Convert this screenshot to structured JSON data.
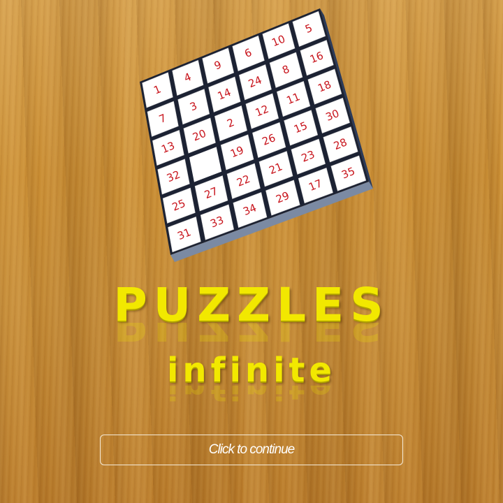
{
  "title": "PUZZLES",
  "subtitle": "infinite",
  "continue_label": "Click to continue",
  "board": {
    "rows": [
      [
        "1",
        "4",
        "9",
        "6",
        "10",
        "5"
      ],
      [
        "7",
        "3",
        "14",
        "24",
        "8",
        "16"
      ],
      [
        "13",
        "20",
        "2",
        "12",
        "11",
        "18"
      ],
      [
        "32",
        "",
        "19",
        "26",
        "15",
        "30"
      ],
      [
        "25",
        "27",
        "22",
        "21",
        "23",
        "28"
      ],
      [
        "31",
        "33",
        "34",
        "29",
        "17",
        "35"
      ]
    ],
    "number_color": "#c8141c",
    "tile_color": "#ffffff",
    "frame_color": "#1c2233"
  },
  "colors": {
    "title": "#f2e800",
    "button_border": "#f4ead8",
    "background": "#c98d33"
  }
}
